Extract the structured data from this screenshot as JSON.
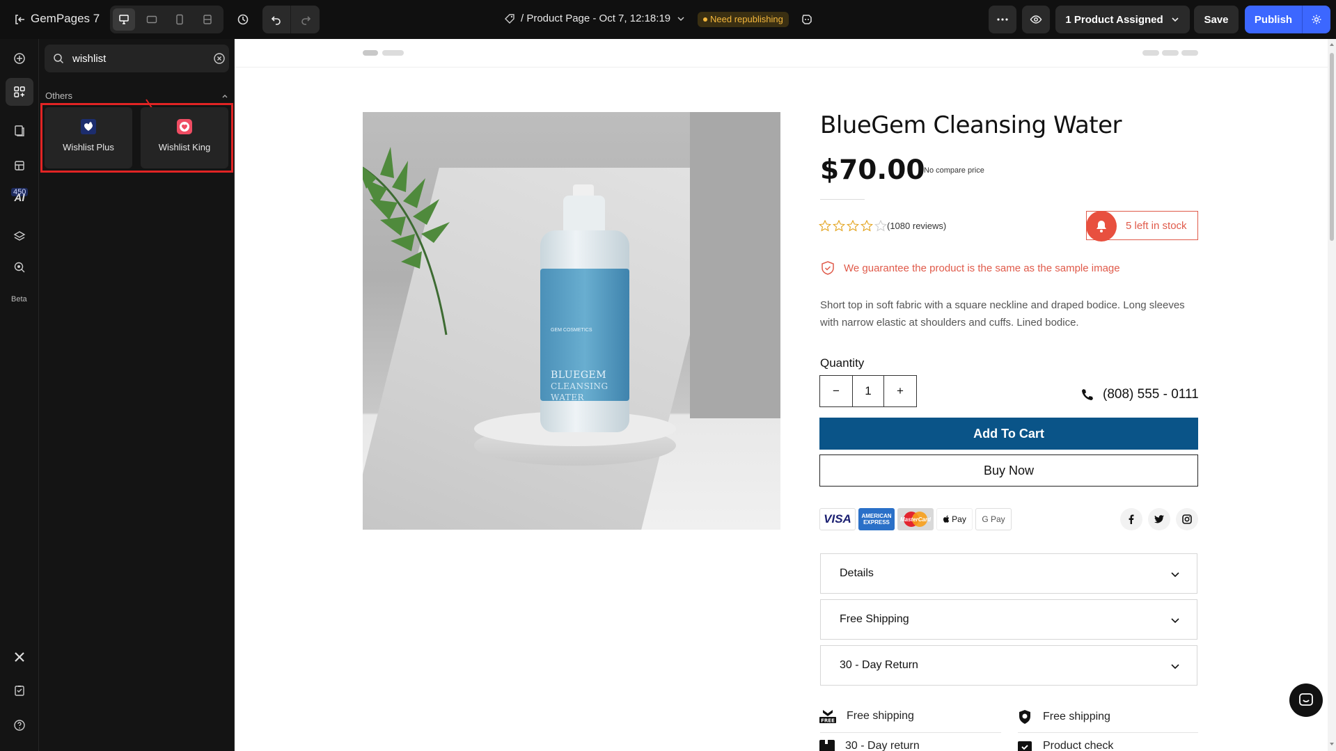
{
  "app": {
    "brand": "GemPages 7",
    "page_title": "/ Product Page - Oct 7, 12:18:19",
    "status_badge": "Need republishing",
    "assigned_label": "1 Product Assigned",
    "save_label": "Save",
    "publish_label": "Publish",
    "accent_color": "#3c67ff"
  },
  "rail": {
    "badge_count": "450",
    "ai_label": "AI",
    "beta_label": "Beta",
    "items": [
      "add-icon",
      "elements-icon",
      "pages-icon",
      "sections-icon",
      "ai-icon",
      "layers-icon",
      "insight-icon",
      "x-icon",
      "checklist-icon",
      "help-icon"
    ]
  },
  "panel": {
    "search_value": "wishlist",
    "section_label": "Others",
    "results": [
      {
        "label": "Wishlist Plus",
        "icon": "wishlist-plus-icon"
      },
      {
        "label": "Wishlist King",
        "icon": "wishlist-king-icon"
      }
    ]
  },
  "product": {
    "image_label_brand": "GEM COSMETICS",
    "image_label_line1": "BLUEGEM",
    "image_label_line2": "CLEANSING",
    "image_label_line3": "WATER",
    "title": "BlueGem Cleansing Water",
    "price": "$70.00",
    "compare_price": "No compare price",
    "rating": 0,
    "rating_max": 5,
    "reviews": "(1080 reviews)",
    "stock": "5 left in stock",
    "guarantee": "We guarantee the product is the same as the sample image",
    "description": "Short top in soft fabric with a square neckline and draped bodice. Long sleeves with narrow elastic at shoulders and cuffs. Lined bodice.",
    "quantity_label": "Quantity",
    "quantity": "1",
    "qty_minus": "−",
    "qty_plus": "+",
    "phone": "(808) 555 - 0111",
    "add_to_cart": "Add To Cart",
    "buy_now": "Buy Now",
    "brand_color": "#0a5488",
    "alert_color": "#e05a4a",
    "payments": {
      "visa": "VISA",
      "amex": "AMERICAN EXPRESS",
      "mastercard": "MasterCard",
      "apple": "Pay",
      "google": "G Pay"
    },
    "accordions": [
      "Details",
      "Free Shipping",
      "30 - Day Return"
    ],
    "features": [
      {
        "label": "Free shipping",
        "icon": "free-shipping-icon"
      },
      {
        "label": "Free shipping",
        "icon": "shield-icon"
      },
      {
        "label": "30 - Day return",
        "icon": "return-icon"
      },
      {
        "label": "Product check",
        "icon": "product-check-icon"
      }
    ]
  }
}
